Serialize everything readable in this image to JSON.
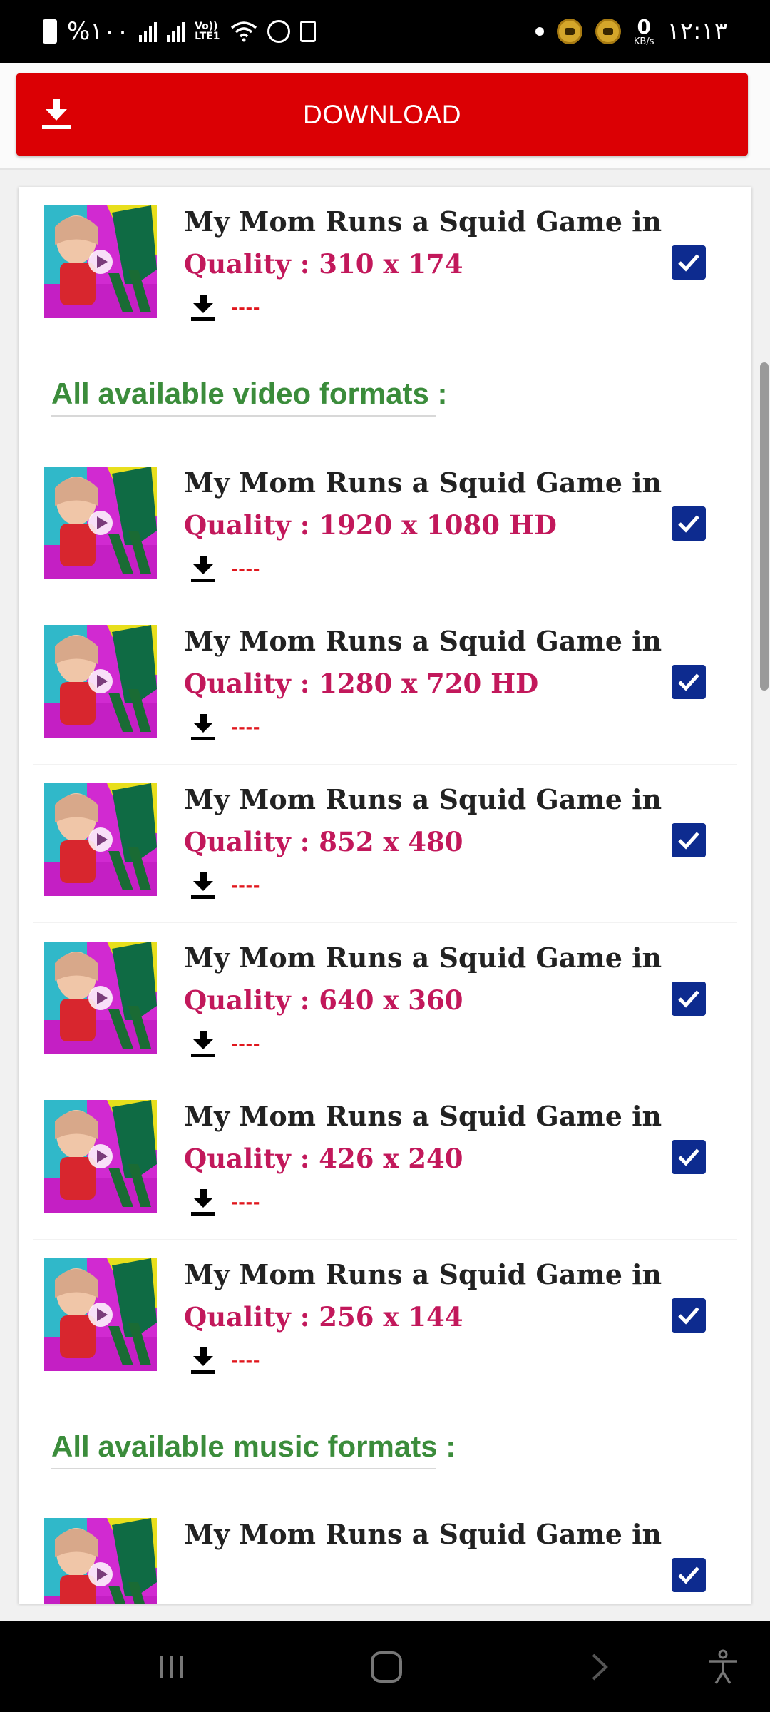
{
  "status_bar": {
    "battery_text": "%۱۰۰",
    "network_label": "Vo))\nLTE1",
    "speed_value": "0",
    "speed_unit": "KB/s",
    "time": "۱۲:۱۳"
  },
  "header": {
    "download_label": "DOWNLOAD",
    "download_icon": "download-icon"
  },
  "top_item": {
    "title": "My Mom Runs a Squid Game in",
    "quality": "Quality : 310 x 174",
    "size": "----",
    "checked": true
  },
  "video_section_title": "All available video formats :",
  "video_items": [
    {
      "title": "My Mom Runs a Squid Game in",
      "quality": "Quality : 1920 x 1080 HD",
      "size": "----",
      "checked": true
    },
    {
      "title": "My Mom Runs a Squid Game in",
      "quality": "Quality : 1280 x 720 HD",
      "size": "----",
      "checked": true
    },
    {
      "title": "My Mom Runs a Squid Game in",
      "quality": "Quality : 852 x 480",
      "size": "----",
      "checked": true
    },
    {
      "title": "My Mom Runs a Squid Game in",
      "quality": "Quality : 640 x 360",
      "size": "----",
      "checked": true
    },
    {
      "title": "My Mom Runs a Squid Game in",
      "quality": "Quality : 426 x 240",
      "size": "----",
      "checked": true
    },
    {
      "title": "My Mom Runs a Squid Game in",
      "quality": "Quality : 256 x 144",
      "size": "----",
      "checked": true
    }
  ],
  "music_section_title": "All available music formats :",
  "music_items": [
    {
      "title": "My Mom Runs a Squid Game in",
      "quality": "",
      "size": "",
      "checked": true
    }
  ],
  "colors": {
    "download_button": "#db0004",
    "quality_text": "#c2185b",
    "section_title": "#3b8c3b",
    "checkbox": "#0d2b8f",
    "size_text": "#e0171d"
  },
  "nav_bar": {
    "icons": [
      "recent-apps-icon",
      "home-icon",
      "back-icon",
      "accessibility-icon"
    ]
  }
}
